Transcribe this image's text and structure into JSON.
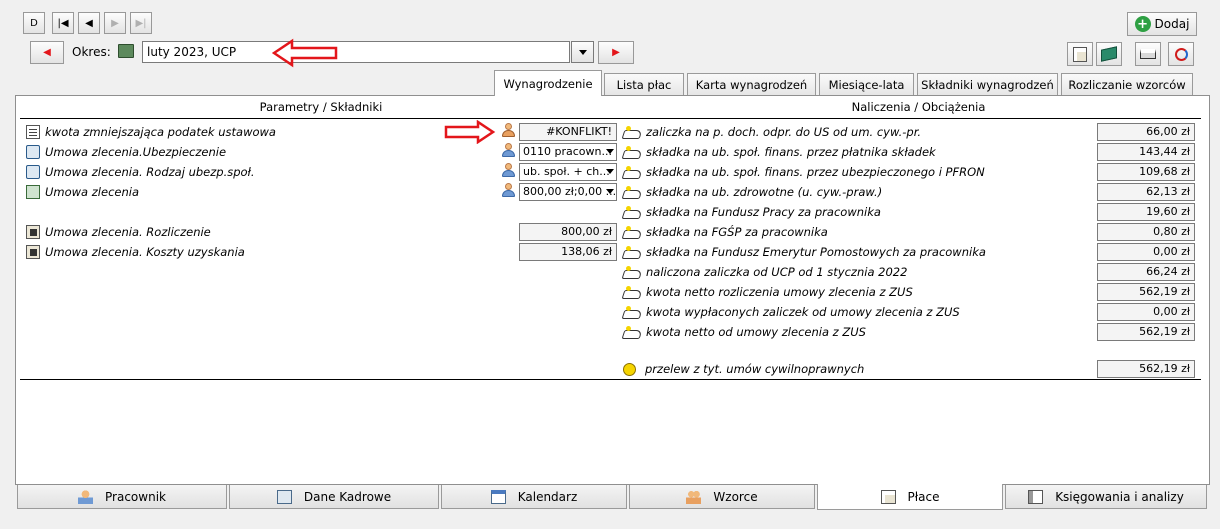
{
  "nav": {
    "buttons": [
      {
        "name": "new-record-button",
        "label": "D",
        "enabled": true
      },
      {
        "name": "first-record-button",
        "label": "|◀",
        "enabled": true
      },
      {
        "name": "prev-record-button",
        "label": "◀",
        "enabled": true
      },
      {
        "name": "next-record-button",
        "label": "▶",
        "enabled": false
      },
      {
        "name": "last-record-button",
        "label": "▶|",
        "enabled": false
      }
    ]
  },
  "add_button": {
    "label": "Dodaj"
  },
  "period": {
    "label": "Okres:",
    "value": "luty 2023, UCP",
    "prev_arrow": "◀",
    "next_arrow": "▶"
  },
  "tabs": [
    {
      "name": "tab-wynagrodzenie",
      "label": "Wynagrodzenie",
      "active": true
    },
    {
      "name": "tab-lista-plac",
      "label": "Lista płac",
      "active": false
    },
    {
      "name": "tab-karta-wynagrodzen",
      "label": "Karta wynagrodzeń",
      "active": false
    },
    {
      "name": "tab-miesiace-lata",
      "label": "Miesiące-lata",
      "active": false
    },
    {
      "name": "tab-skladniki-wynagrodzen",
      "label": "Składniki wynagrodzeń",
      "active": false
    },
    {
      "name": "tab-rozliczanie-wzorcow",
      "label": "Rozliczanie wzorców",
      "active": false
    }
  ],
  "left": {
    "header": "Parametry / Składniki",
    "rows": [
      {
        "icon": "document-list-icon",
        "label": "kwota zmniejszająca podatek ustawowa",
        "person_icon": "group-users-icon",
        "value": "#KONFLIKT!",
        "kind": "value"
      },
      {
        "icon": "contract-icon",
        "label": "Umowa zlecenia.Ubezpieczenie",
        "person_icon": "user-icon",
        "value": "0110 pracown...",
        "kind": "combo"
      },
      {
        "icon": "contract-icon",
        "label": "Umowa zlecenia. Rodzaj ubezp.społ.",
        "person_icon": "user-icon",
        "value": "ub. społ. + ch...",
        "kind": "combo"
      },
      {
        "icon": "table-icon",
        "label": "Umowa zlecenia",
        "person_icon": "user-icon",
        "value": "800,00 zł;0,00 ...",
        "kind": "combo"
      },
      {
        "icon": "calculator-doc-icon",
        "label": "Umowa zlecenia. Rozliczenie",
        "person_icon": "",
        "value": "800,00 zł",
        "kind": "value"
      },
      {
        "icon": "calculator-doc-icon",
        "label": "Umowa zlecenia. Koszty uzyskania",
        "person_icon": "",
        "value": "138,06 zł",
        "kind": "value"
      }
    ]
  },
  "right": {
    "header": "Naliczenia / Obciążenia",
    "rows": [
      {
        "label": "zaliczka na p. doch. odpr. do US od um. cyw.-pr.",
        "value": "66,00 zł"
      },
      {
        "label": "składka na ub. społ. finans. przez płatnika składek",
        "value": "143,44 zł"
      },
      {
        "label": "składka na ub. społ. finans. przez ubezpieczonego i PFRON",
        "value": "109,68 zł"
      },
      {
        "label": "składka na ub. zdrowotne (u. cyw.-praw.)",
        "value": "62,13 zł"
      },
      {
        "label": "składka na Fundusz Pracy za pracownika",
        "value": "19,60 zł"
      },
      {
        "label": "składka na FGŚP za pracownika",
        "value": "0,80 zł"
      },
      {
        "label": "składka na Fundusz Emerytur Pomostowych za pracownika",
        "value": "0,00 zł"
      },
      {
        "label": "naliczona zaliczka od UCP od 1 stycznia 2022",
        "value": "66,24 zł"
      },
      {
        "label": "kwota netto rozliczenia umowy zlecenia z ZUS",
        "value": "562,19 zł"
      },
      {
        "label": "kwota wypłaconych zaliczek od umowy zlecenia z ZUS",
        "value": "0,00 zł"
      },
      {
        "label": "kwota netto od umowy zlecenia z ZUS",
        "value": "562,19 zł"
      }
    ],
    "total": {
      "icon": "coin-icon",
      "label": "przelew z tyt. umów cywilnoprawnych",
      "value": "562,19 zł"
    }
  },
  "bottom_tabs": [
    {
      "name": "bottom-tab-pracownik",
      "icon": "user-icon",
      "label": "Pracownik",
      "active": false
    },
    {
      "name": "bottom-tab-dane-kadrowe",
      "icon": "id-card-icon",
      "label": "Dane Kadrowe",
      "active": false
    },
    {
      "name": "bottom-tab-kalendarz",
      "icon": "calendar-icon",
      "label": "Kalendarz",
      "active": false
    },
    {
      "name": "bottom-tab-wzorce",
      "icon": "group-users-icon",
      "label": "Wzorce",
      "active": false
    },
    {
      "name": "bottom-tab-place",
      "icon": "calculator-icon",
      "label": "Płace",
      "active": true
    },
    {
      "name": "bottom-tab-ksiegowania",
      "icon": "ledger-icon",
      "label": "Księgowania i analizy",
      "active": false
    }
  ],
  "colors": {
    "arrow_red": "#e3161b",
    "accent_green": "#2ea043",
    "panel_border": "#8f8f8f"
  }
}
